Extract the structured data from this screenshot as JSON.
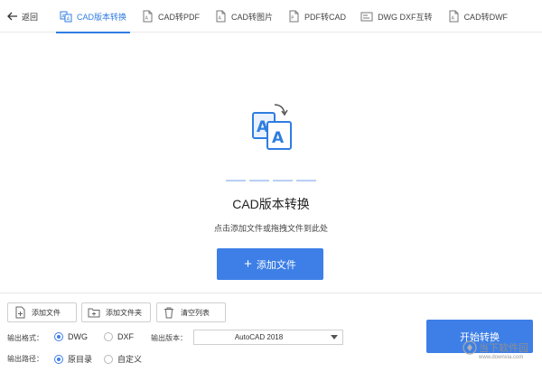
{
  "topbar": {
    "back_label": "返回",
    "tabs": [
      {
        "label": "CAD版本转换",
        "icon": "cad-version-icon",
        "active": true
      },
      {
        "label": "CAD转PDF",
        "icon": "pdf-file-icon",
        "active": false
      },
      {
        "label": "CAD转图片",
        "icon": "image-file-icon",
        "active": false
      },
      {
        "label": "PDF转CAD",
        "icon": "pdf-to-cad-icon",
        "active": false
      },
      {
        "label": "DWG DXF互转",
        "icon": "dwg-dxf-icon",
        "active": false
      },
      {
        "label": "CAD转DWF",
        "icon": "dwf-file-icon",
        "active": false
      }
    ]
  },
  "main": {
    "title": "CAD版本转换",
    "hint": "点击添加文件或拖拽文件到此处",
    "add_button": "添加文件",
    "hero_icon": "letter-a-convert-icon"
  },
  "toolbar": {
    "add_file": "添加文件",
    "add_folder": "添加文件夹",
    "clear_list": "清空列表"
  },
  "options": {
    "format_label": "输出格式：",
    "format_options": [
      "DWG",
      "DXF"
    ],
    "format_selected": "DWG",
    "version_label": "输出版本：",
    "version_value": "AutoCAD 2018",
    "path_label": "输出路径：",
    "path_options": [
      "原目录",
      "自定义"
    ],
    "path_selected": "原目录"
  },
  "start_button": "开始转换",
  "watermark": {
    "name": "当下软件园",
    "url": "www.downxia.com"
  },
  "colors": {
    "accent": "#3d7fe6",
    "tab_active": "#2f7de1",
    "border": "#cfcfcf"
  }
}
